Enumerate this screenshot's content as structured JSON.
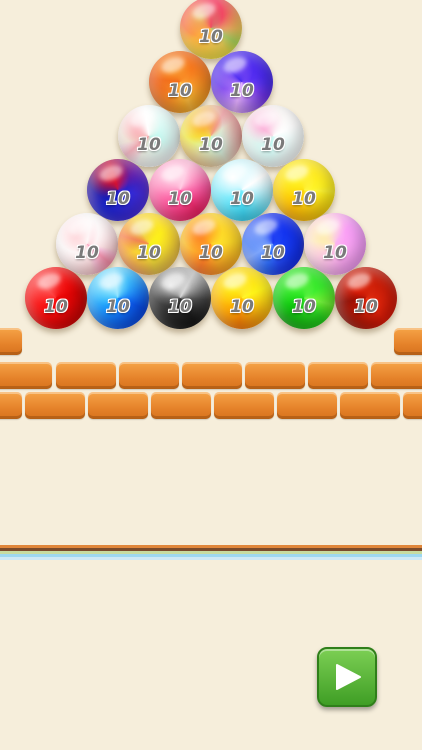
{
  "game": {
    "ball_value": "10",
    "balls": [
      {
        "row": 0,
        "col": 0,
        "colors": [
          "#e94b6b",
          "#5fd08a",
          "#f5c24a"
        ]
      },
      {
        "row": 1,
        "col": 0,
        "colors": [
          "#e07b3a",
          "#f7c48a",
          "#b35a22"
        ]
      },
      {
        "row": 1,
        "col": 1,
        "colors": [
          "#6b4fd8",
          "#e8c8f7",
          "#3c2bb0"
        ]
      },
      {
        "row": 2,
        "col": 0,
        "colors": [
          "#9fe0cf",
          "#e85f6b",
          "#ffffff"
        ]
      },
      {
        "row": 2,
        "col": 1,
        "colors": [
          "#9fe6cf",
          "#f0a030",
          "#e85f6b"
        ]
      },
      {
        "row": 2,
        "col": 2,
        "colors": [
          "#a8ecdc",
          "#f28fb5",
          "#ffffff"
        ]
      },
      {
        "row": 3,
        "col": 0,
        "colors": [
          "#2f3fa8",
          "#d0283a",
          "#6a4fc8"
        ]
      },
      {
        "row": 3,
        "col": 1,
        "colors": [
          "#f07a9a",
          "#ffc4d4",
          "#d94070"
        ]
      },
      {
        "row": 3,
        "col": 2,
        "colors": [
          "#8fd4ee",
          "#ffffff",
          "#4fb4dd"
        ]
      },
      {
        "row": 3,
        "col": 3,
        "colors": [
          "#f5c02a",
          "#fff08a",
          "#e09010"
        ]
      },
      {
        "row": 4,
        "col": 0,
        "colors": [
          "#f7f0f0",
          "#e85a6b",
          "#f4c8c8"
        ]
      },
      {
        "row": 4,
        "col": 1,
        "colors": [
          "#f5d23a",
          "#7fd04a",
          "#e9508a"
        ]
      },
      {
        "row": 4,
        "col": 2,
        "colors": [
          "#f7c14a",
          "#e95a4a",
          "#f59a3a"
        ]
      },
      {
        "row": 4,
        "col": 3,
        "colors": [
          "#3b5fe0",
          "#aab8f7",
          "#2238b5"
        ]
      },
      {
        "row": 4,
        "col": 4,
        "colors": [
          "#f59ad0",
          "#f7e08a",
          "#c887e8"
        ]
      },
      {
        "row": 5,
        "col": 0,
        "colors": [
          "#e02828",
          "#f57070",
          "#a01010"
        ]
      },
      {
        "row": 5,
        "col": 1,
        "colors": [
          "#3c8ee8",
          "#a8d8f7",
          "#1e5bc0"
        ]
      },
      {
        "row": 5,
        "col": 2,
        "colors": [
          "#5a5a5a",
          "#d8d8d8",
          "#333333"
        ]
      },
      {
        "row": 5,
        "col": 3,
        "colors": [
          "#f5a81a",
          "#fff078",
          "#e0781a"
        ]
      },
      {
        "row": 5,
        "col": 4,
        "colors": [
          "#3fbf3a",
          "#a8ef88",
          "#1f8a1f"
        ]
      },
      {
        "row": 5,
        "col": 5,
        "colors": [
          "#a8381a",
          "#e87050",
          "#6a1a08"
        ]
      }
    ]
  },
  "colors": {
    "background": "#f6eedb",
    "stripes": [
      "#e0863a",
      "#7a4a2a",
      "#c8dca0",
      "#9ed8f0",
      "#cfe9f5"
    ],
    "play_button": "#4fb531"
  },
  "controls": {
    "play_icon": "play-icon"
  }
}
